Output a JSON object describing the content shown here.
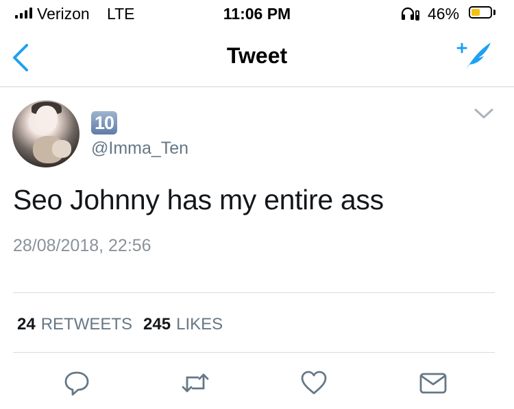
{
  "status_bar": {
    "carrier": "Verizon",
    "network": "LTE",
    "time": "11:06 PM",
    "battery_percent": "46%",
    "battery_level": 0.46,
    "icons": [
      "signal-bars-icon",
      "headphones-icon",
      "battery-icon"
    ]
  },
  "nav": {
    "title": "Tweet",
    "back_icon": "chevron-left-icon",
    "compose_icon": "compose-tweet-icon",
    "accent_color": "#1da1f2"
  },
  "tweet": {
    "name_badge": "10",
    "handle": "@Imma_Ten",
    "text": "Seo Johnny has my entire ass",
    "timestamp": "28/08/2018, 22:56",
    "retweets_count": "24",
    "retweets_label": "RETWEETS",
    "likes_count": "245",
    "likes_label": "LIKES"
  },
  "actions": [
    "reply-icon",
    "retweet-icon",
    "like-icon",
    "direct-message-icon"
  ]
}
